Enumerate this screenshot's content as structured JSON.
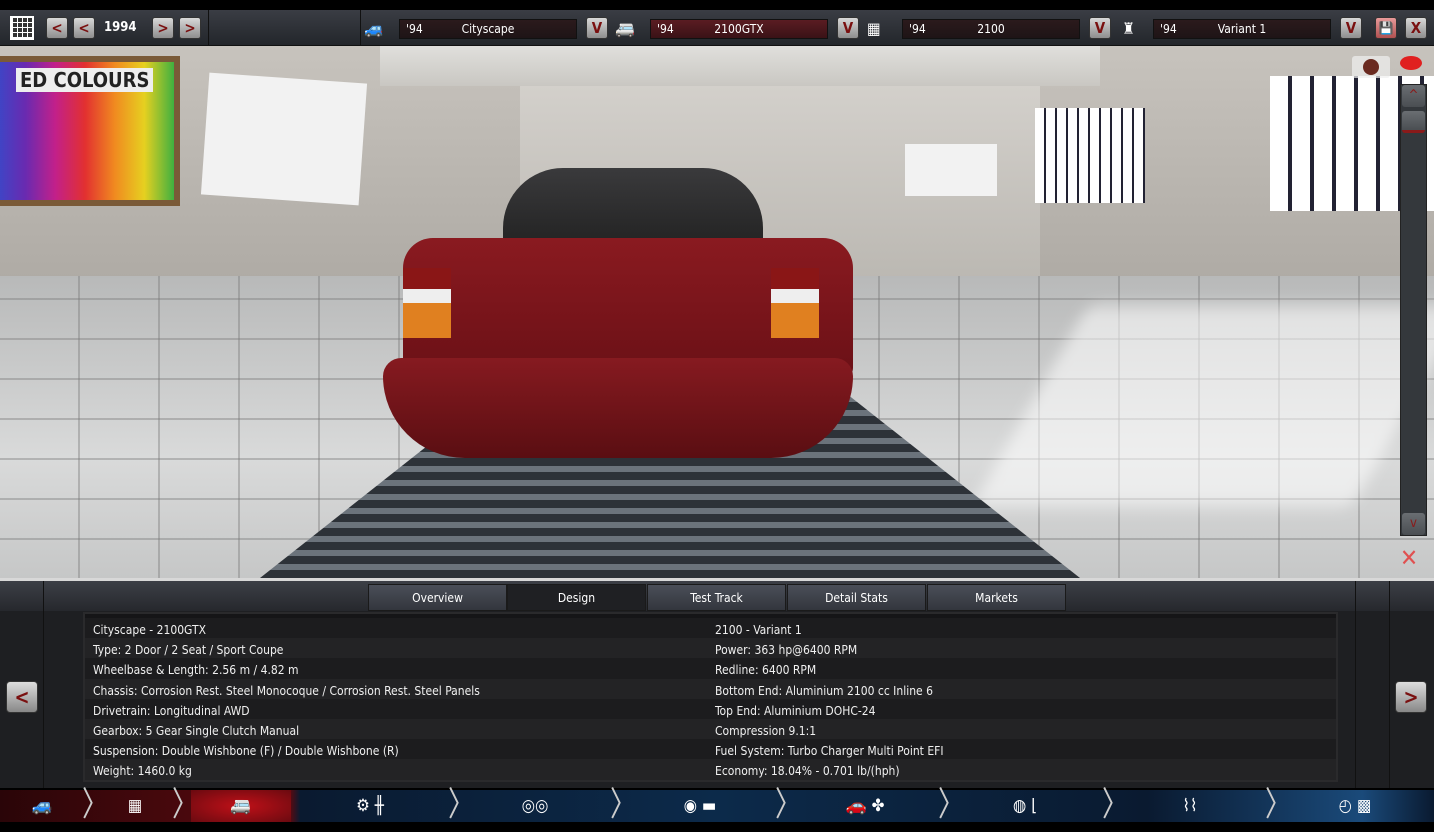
{
  "topbar": {
    "year": "1994",
    "prev_label": "<",
    "next_label": ">",
    "calendar_icon": "calendar-icon",
    "selectors": [
      {
        "icon": "car-body-icon",
        "glyph": "🚙",
        "year": "'94",
        "name": "Cityscape",
        "dropdown": "V"
      },
      {
        "icon": "trim-icon",
        "glyph": "🚐",
        "year": "'94",
        "name": "2100GTX",
        "dropdown": "V"
      },
      {
        "icon": "engine-icon",
        "glyph": "▦",
        "year": "'94",
        "name": "2100",
        "dropdown": "V"
      },
      {
        "icon": "piston-icon",
        "glyph": "♜",
        "year": "'94",
        "name": "Variant 1",
        "dropdown": "V"
      }
    ],
    "save_glyph": "💾",
    "close_label": "X"
  },
  "scene": {
    "poster_text": "ED COLOURS",
    "scroll_up": "^",
    "scroll_down": "v"
  },
  "tabs": [
    "Overview",
    "Design",
    "Test Track",
    "Detail Stats",
    "Markets"
  ],
  "active_tab": "Design",
  "info": {
    "left": [
      "Cityscape - 2100GTX",
      "Type: 2 Door / 2 Seat / Sport Coupe",
      "Wheelbase & Length: 2.56 m / 4.82 m",
      "Chassis: Corrosion Rest. Steel Monocoque / Corrosion Rest. Steel Panels",
      "Drivetrain: Longitudinal AWD",
      "Gearbox: 5 Gear Single Clutch Manual",
      "Suspension: Double Wishbone (F) / Double Wishbone (R)",
      "Weight: 1460.0 kg"
    ],
    "right": [
      "2100 - Variant 1",
      "Power: 363 hp@6400 RPM",
      "Redline: 6400 RPM",
      "Bottom End: Aluminium 2100 cc Inline 6",
      "Top End: Aluminium DOHC-24",
      "Compression 9.1:1",
      "Fuel System: Turbo Charger Multi Point EFI",
      "Economy: 18.04% - 0.701 lb/(hph)"
    ]
  },
  "nav": {
    "prev": "<",
    "next": ">"
  },
  "bottom_steps": [
    {
      "name": "model",
      "glyph": "🚙"
    },
    {
      "name": "engine",
      "glyph": "▦"
    },
    {
      "name": "trim",
      "glyph": "🚐"
    },
    {
      "name": "drivetrain",
      "glyph": "⚙ ╫"
    },
    {
      "name": "wheels",
      "glyph": "◎◎"
    },
    {
      "name": "brakes",
      "glyph": "◉ ▬"
    },
    {
      "name": "aero-cooling",
      "glyph": "🚗 ✤"
    },
    {
      "name": "interior",
      "glyph": "◍ ⌊"
    },
    {
      "name": "suspension",
      "glyph": "⌇⌇"
    },
    {
      "name": "test",
      "glyph": "◴ ▩"
    }
  ],
  "colors": {
    "accent": "#7a1010",
    "active_step": "#c01018"
  }
}
